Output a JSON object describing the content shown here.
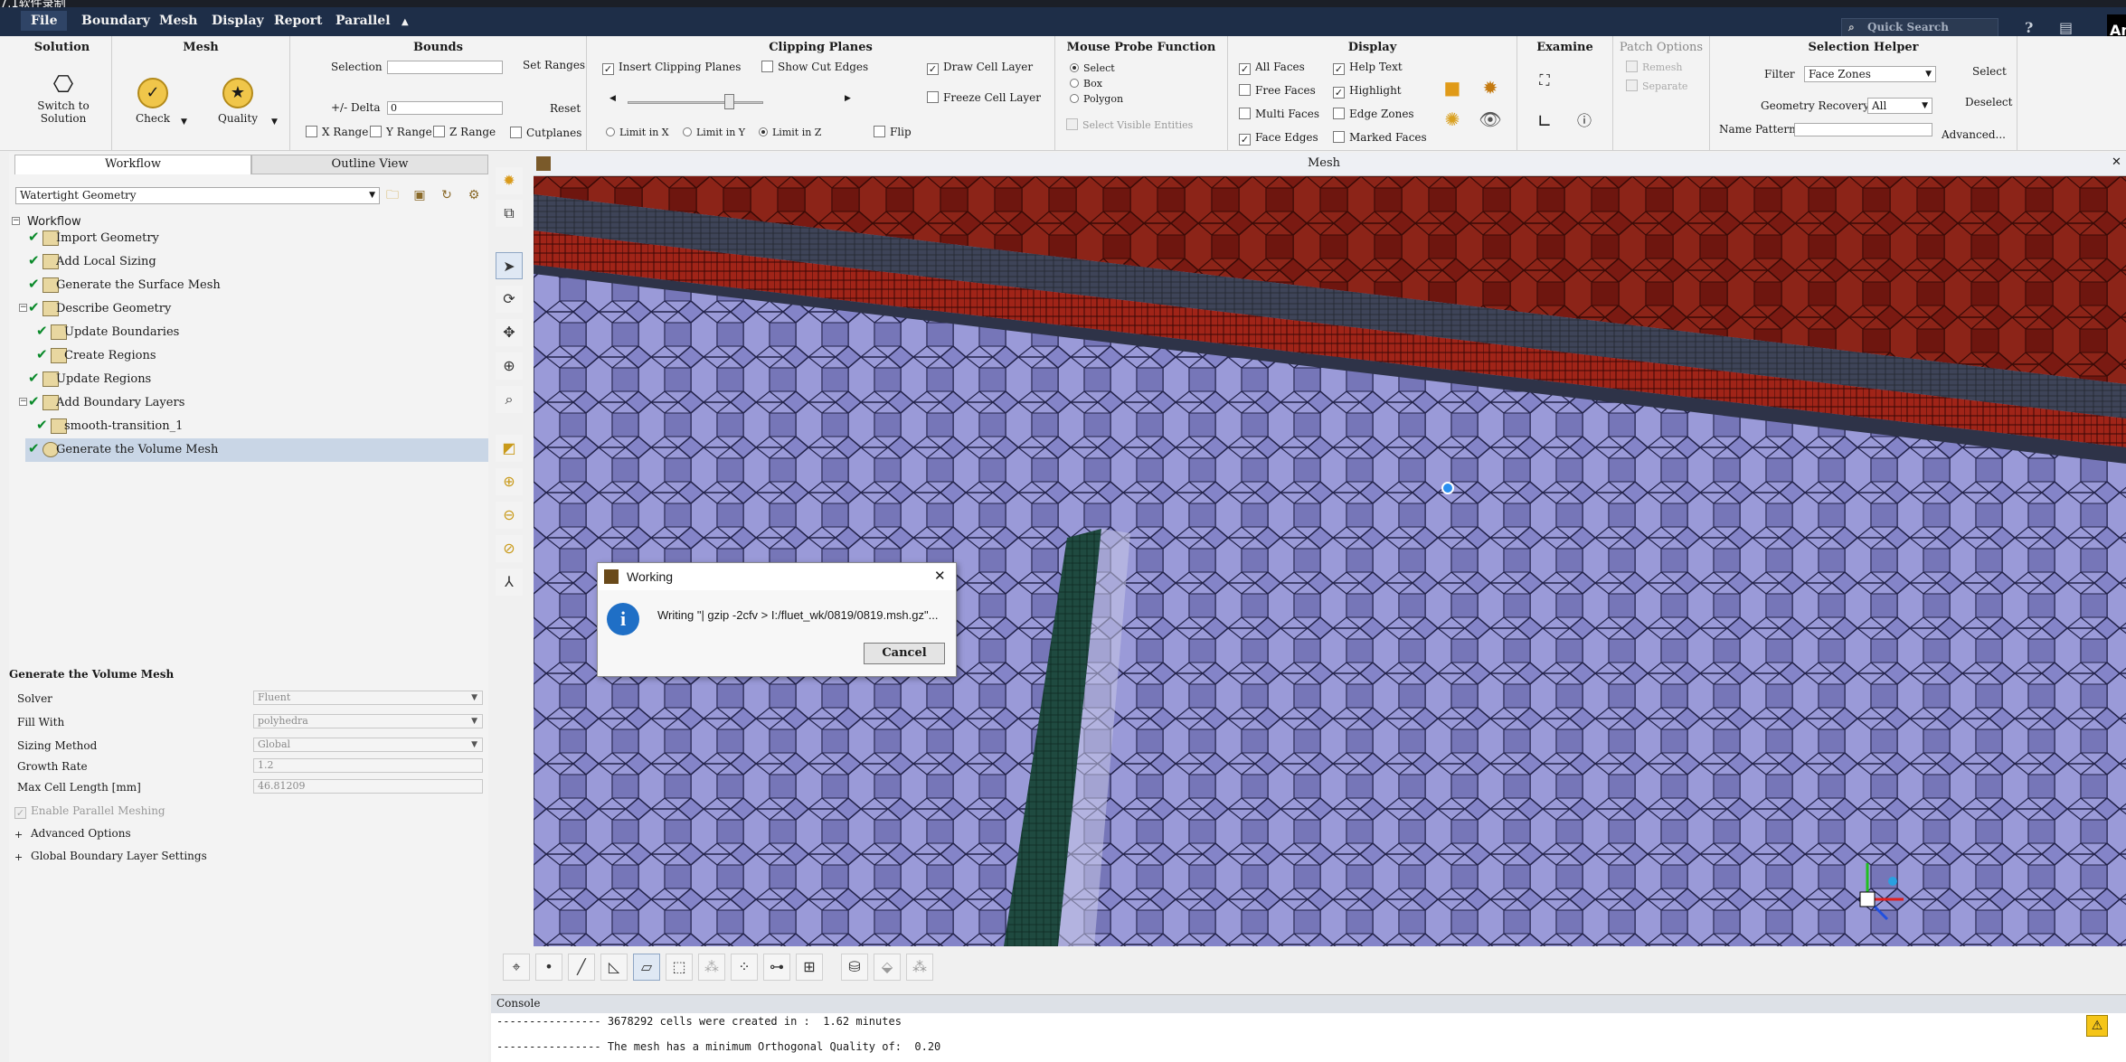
{
  "window": {
    "title": "7.1软件录制"
  },
  "menu": {
    "items": [
      "File",
      "Boundary",
      "Mesh",
      "Display",
      "Report",
      "Parallel"
    ],
    "collapse_glyph": "▲",
    "search_placeholder": "Quick Search",
    "brand": "An"
  },
  "ribbon": {
    "solution": {
      "title": "Solution",
      "switch_label": "Switch to\nSolution"
    },
    "mesh": {
      "title": "Mesh",
      "check_label": "Check",
      "quality_label": "Quality"
    },
    "bounds": {
      "title": "Bounds",
      "selection_label": "Selection",
      "selection_value": "",
      "set_ranges": "Set Ranges",
      "delta_label": "+/- Delta",
      "delta_value": "0",
      "reset": "Reset",
      "x_range": "X Range",
      "y_range": "Y Range",
      "z_range": "Z Range",
      "cutplanes": "Cutplanes"
    },
    "clipping": {
      "title": "Clipping Planes",
      "insert": "Insert Clipping Planes",
      "insert_checked": true,
      "show_cut_edges": "Show Cut Edges",
      "draw_cell_layer": "Draw Cell Layer",
      "draw_cell_layer_checked": true,
      "freeze_cell_layer": "Freeze Cell Layer",
      "limit_x": "Limit in X",
      "limit_y": "Limit in Y",
      "limit_z": "Limit in Z",
      "limit_selected": "Limit in Z",
      "flip": "Flip"
    },
    "probe": {
      "title": "Mouse Probe Function",
      "select": "Select",
      "box": "Box",
      "polygon": "Polygon",
      "selected": "Select",
      "select_visible": "Select Visible Entities"
    },
    "display": {
      "title": "Display",
      "all_faces": "All Faces",
      "free_faces": "Free Faces",
      "multi_faces": "Multi Faces",
      "face_edges": "Face Edges",
      "help_text": "Help Text",
      "highlight": "Highlight",
      "edge_zones": "Edge Zones",
      "marked_faces": "Marked Faces"
    },
    "examine": {
      "title": "Examine"
    },
    "patch": {
      "title": "Patch Options",
      "remesh": "Remesh",
      "separate": "Separate"
    },
    "helper": {
      "title": "Selection Helper",
      "filter_label": "Filter",
      "filter_value": "Face Zones",
      "recovery_label": "Geometry Recovery",
      "recovery_value": "All",
      "name_pattern_label": "Name Pattern",
      "name_pattern_value": "",
      "select": "Select",
      "deselect": "Deselect",
      "advanced": "Advanced..."
    }
  },
  "left": {
    "tabs": [
      "Workflow",
      "Outline View"
    ],
    "workflow_type": "Watertight Geometry",
    "tree_root": "Workflow",
    "tree": [
      {
        "label": "Import Geometry"
      },
      {
        "label": "Add Local Sizing"
      },
      {
        "label": "Generate the Surface Mesh"
      },
      {
        "label": "Describe Geometry"
      },
      {
        "label": "Update Boundaries"
      },
      {
        "label": "Create Regions"
      },
      {
        "label": "Update Regions"
      },
      {
        "label": "Add Boundary Layers"
      },
      {
        "label": "smooth-transition_1"
      },
      {
        "label": "Generate the Volume Mesh"
      }
    ],
    "task": {
      "title": "Generate the Volume Mesh",
      "solver_label": "Solver",
      "solver_value": "Fluent",
      "fill_label": "Fill With",
      "fill_value": "polyhedra",
      "sizing_label": "Sizing Method",
      "sizing_value": "Global",
      "growth_label": "Growth Rate",
      "growth_value": "1.2",
      "maxcell_label": "Max Cell Length [mm]",
      "maxcell_value": "46.81209",
      "parallel_label": "Enable Parallel Meshing",
      "advanced_label": "Advanced Options",
      "bl_label": "Global Boundary Layer Settings"
    }
  },
  "graphics": {
    "title": "Mesh",
    "close_glyph": "✕"
  },
  "console": {
    "title": "Console",
    "lines": [
      "---------------- 3678292 cells were created in :  1.62 minutes",
      "---------------- The mesh has a minimum Orthogonal Quality of:  0.20"
    ]
  },
  "dialog": {
    "title": "Working",
    "message": "Writing \"| gzip -2cfv > I:/fluet_wk/0819/0819.msh.gz\"...",
    "cancel": "Cancel",
    "close_glyph": "✕",
    "info_glyph": "i"
  },
  "colors": {
    "menu_bg": "#1e2e48",
    "mesh_top": "#7a1810",
    "mesh_bottom": "#8c8cd0",
    "mesh_wall": "#1f4a40"
  }
}
